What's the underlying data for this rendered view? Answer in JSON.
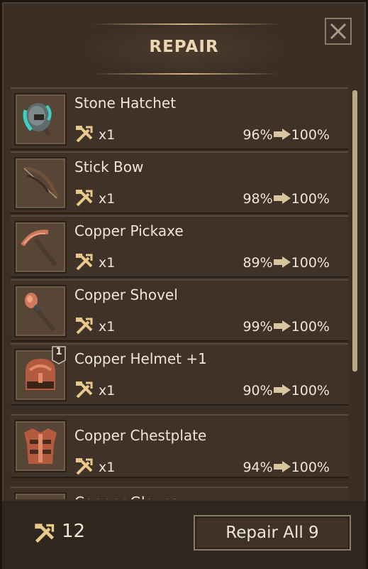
{
  "header": {
    "title": "REPAIR",
    "close_icon": "close-x-icon"
  },
  "items": [
    {
      "name": "Stone Hatchet",
      "count": "x1",
      "from": "96%",
      "to": "100%",
      "icon": "stone-hatchet-icon",
      "accent": "#3ccfc3"
    },
    {
      "name": "Stick Bow",
      "count": "x1",
      "from": "98%",
      "to": "100%",
      "icon": "stick-bow-icon",
      "accent": "#7a5a3c"
    },
    {
      "name": "Copper Pickaxe",
      "count": "x1",
      "from": "89%",
      "to": "100%",
      "icon": "copper-pickaxe-icon",
      "accent": "#d0785a"
    },
    {
      "name": "Copper Shovel",
      "count": "x1",
      "from": "99%",
      "to": "100%",
      "icon": "copper-shovel-icon",
      "accent": "#d0785a"
    },
    {
      "name": "Copper Helmet +1",
      "count": "x1",
      "from": "90%",
      "to": "100%",
      "icon": "copper-helmet-icon",
      "accent": "#c8684a",
      "badge": "1"
    },
    {
      "name": "Copper Chestplate",
      "count": "x1",
      "from": "94%",
      "to": "100%",
      "icon": "copper-chestplate-icon",
      "accent": "#c8684a"
    },
    {
      "name": "Copper Gloves",
      "icon": "copper-gloves-icon"
    }
  ],
  "footer": {
    "repair_kits": "12",
    "repair_all_label": "Repair All 9"
  },
  "colors": {
    "panel_bg": "#3b2f25",
    "text": "#efe6d6",
    "title": "#ead7b3",
    "tool_icon": "#e8c98a",
    "arrow": "#d9c4a0"
  }
}
